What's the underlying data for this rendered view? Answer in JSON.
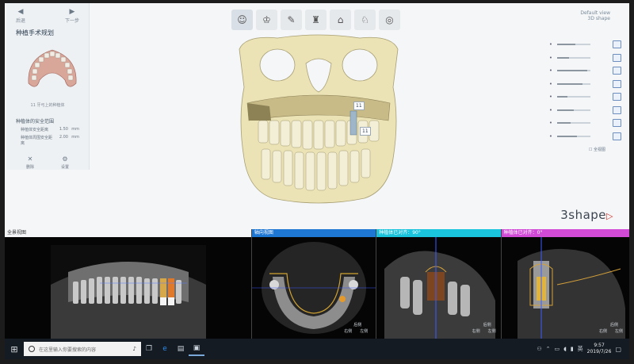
{
  "toolbar": {
    "buttons": [
      "patient-icon",
      "tooth-icon",
      "implant-icon",
      "sleeve-icon",
      "guide-icon",
      "drill-icon",
      "export-icon"
    ]
  },
  "top_right": {
    "line1": "Default view",
    "line2": "3D shape"
  },
  "left_panel": {
    "nav_prev_label": "后退",
    "nav_next_label": "下一步",
    "title": "种植手术规划",
    "thumb_caption": "11 牙弓上的种植体",
    "section_title": "种植体的安全范围",
    "settings": [
      {
        "label": "种植体安全距离",
        "value": "1.50",
        "unit": "mm"
      },
      {
        "label": "种植体周围安全距离",
        "value": "2.00",
        "unit": "mm"
      }
    ],
    "action_left": "删除",
    "action_right": "设置"
  },
  "right_controls": {
    "levels": [
      0.55,
      0.35,
      0.9,
      0.75,
      0.3,
      0.5,
      0.4,
      0.6
    ],
    "fullview_label": "☐ 全视图"
  },
  "tooth_labels": [
    "11",
    "11"
  ],
  "brand": "3shape",
  "panes": [
    {
      "title": "全景视图",
      "header_color": "#f4f6f8",
      "text_color": "#333333"
    },
    {
      "title": "轴向视图",
      "header_color": "#1f77d4",
      "text_color": "#ffffff",
      "tag_a": "后侧",
      "tag_b": "右侧",
      "tag_c": "左侧"
    },
    {
      "title": "种植体已对齐：90°",
      "header_color": "#19c4dc",
      "text_color": "#ffffff",
      "tag_a": "后侧",
      "tag_b": "右侧",
      "tag_c": "左侧"
    },
    {
      "title": "种植体已对齐：0°",
      "header_color": "#d14bd6",
      "text_color": "#ffffff",
      "tag_a": "后侧",
      "tag_b": "右侧",
      "tag_c": "左侧"
    }
  ],
  "taskbar": {
    "search_placeholder": "在这里输入你要搜索的内容",
    "time": "9:57",
    "date": "2019/7/26"
  }
}
